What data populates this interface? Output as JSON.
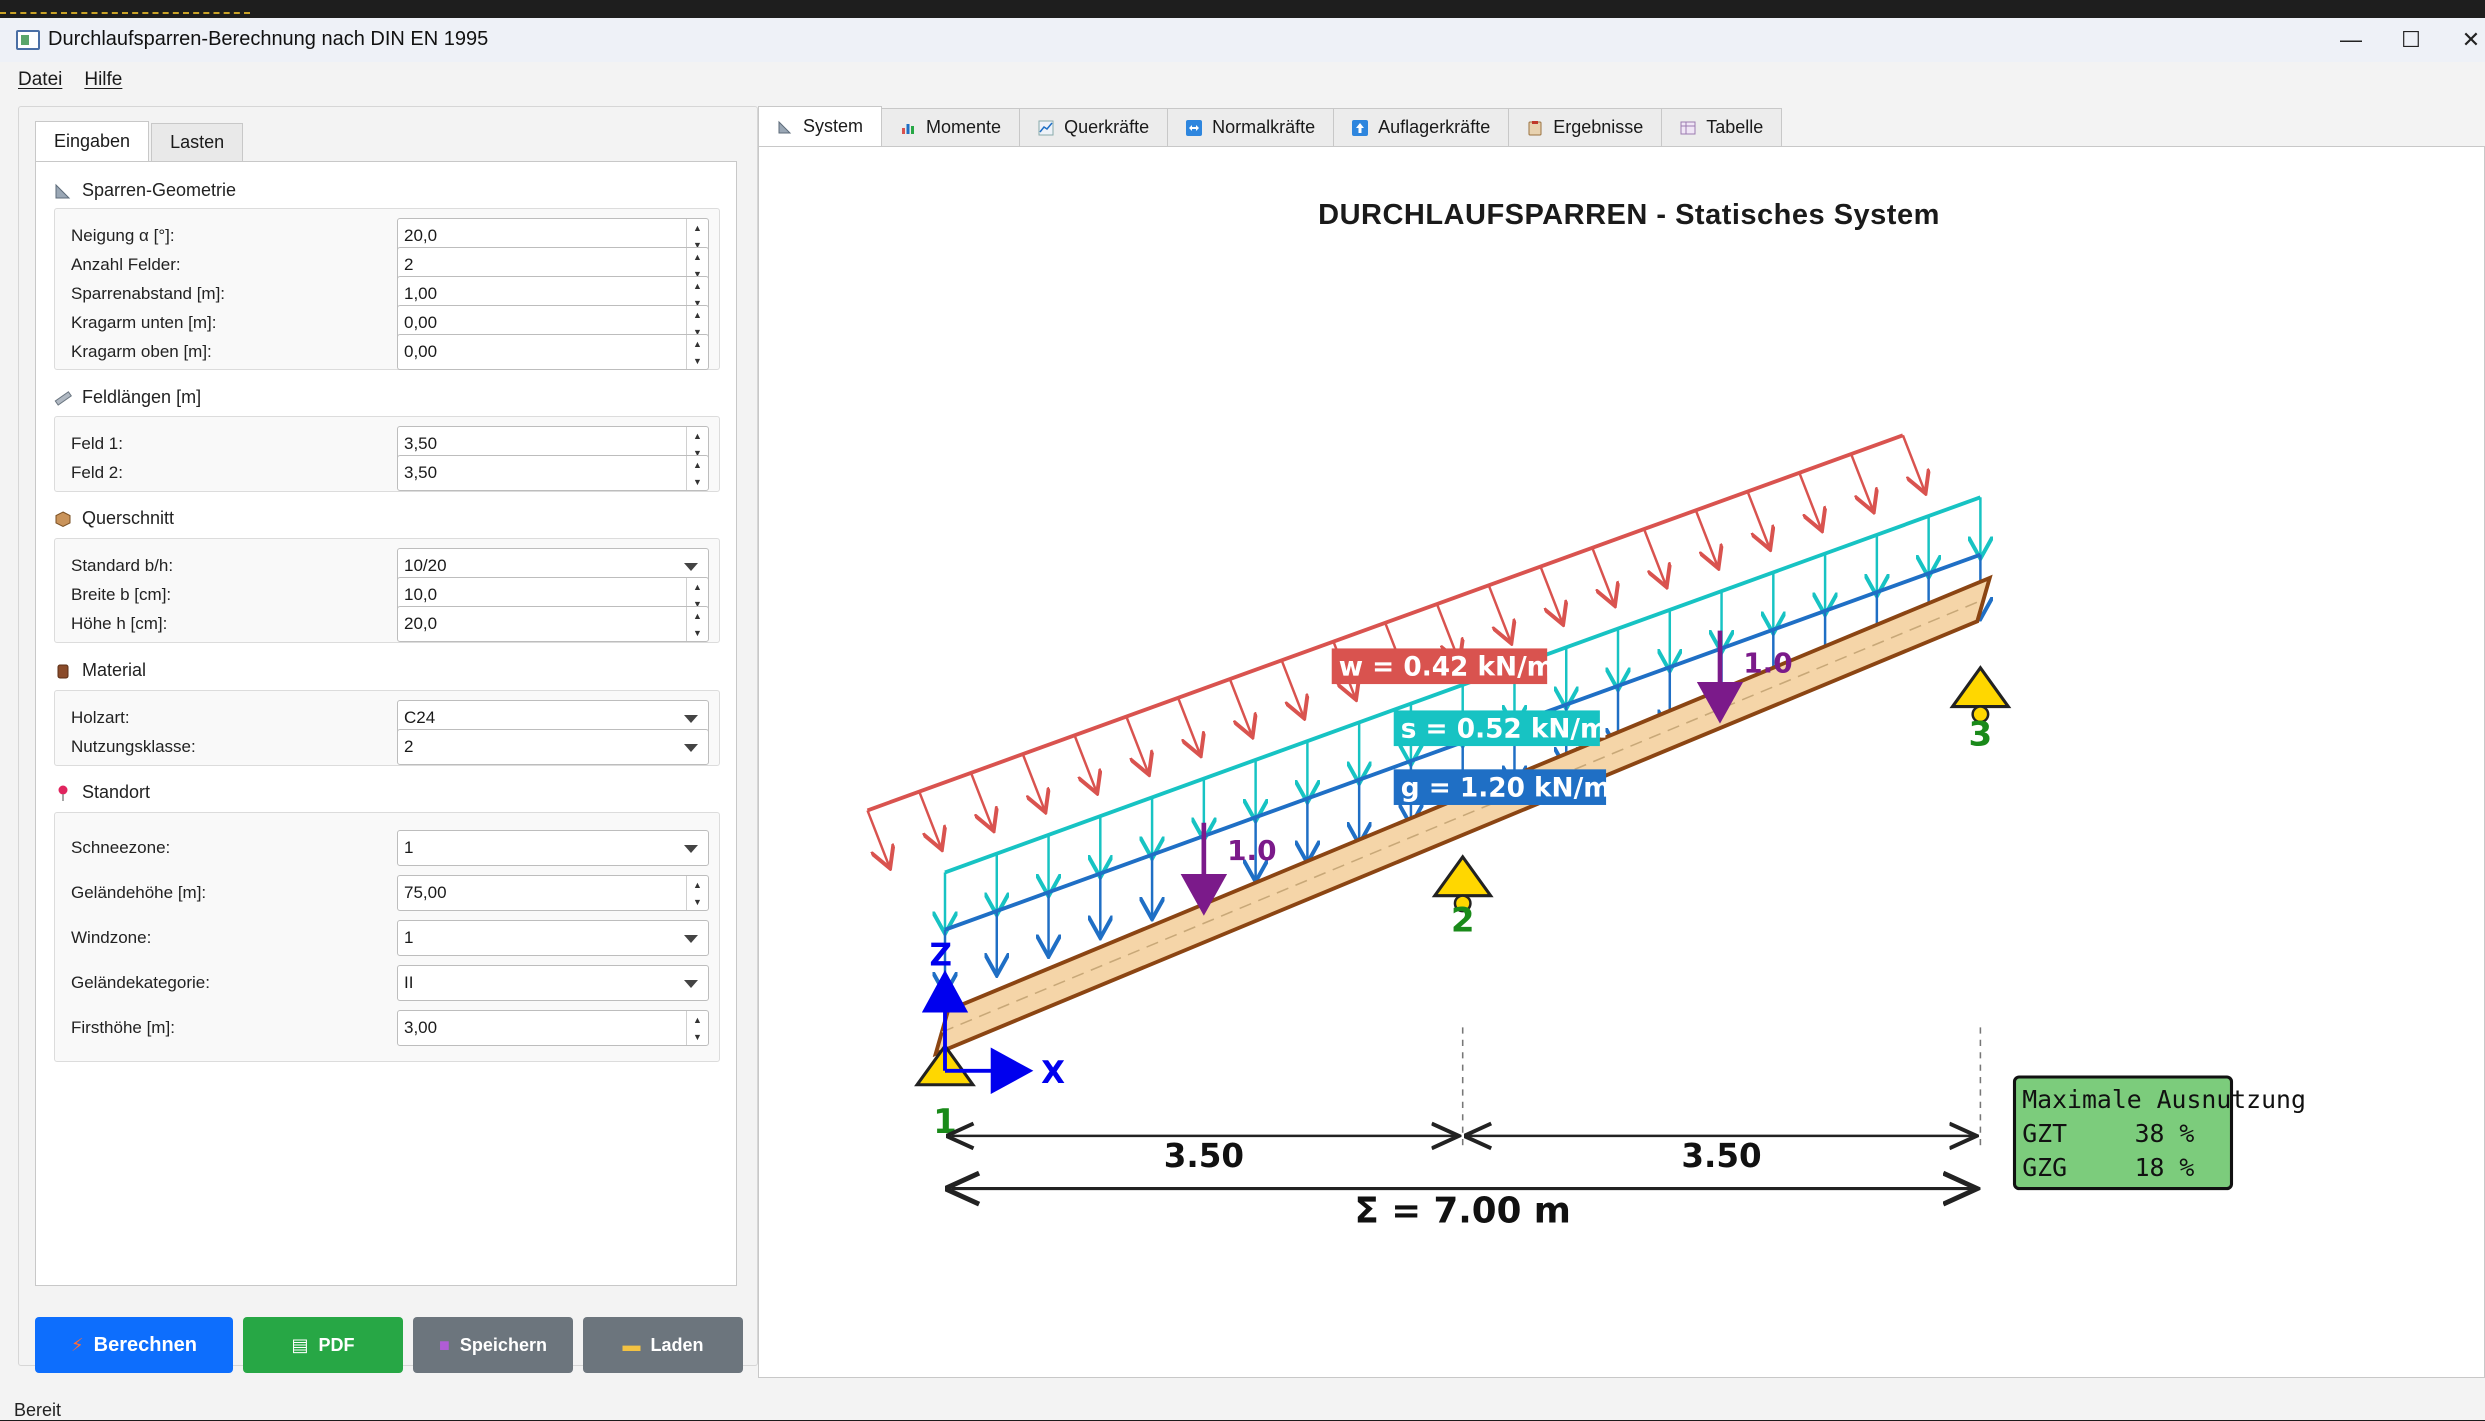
{
  "window": {
    "title": "Durchlaufsparren-Berechnung nach DIN EN 1995"
  },
  "menu": {
    "file": "Datei",
    "help": "Hilfe"
  },
  "left_tabs": [
    "Eingaben",
    "Lasten"
  ],
  "groups": {
    "geometry": {
      "title": "Sparren-Geometrie",
      "fields": [
        {
          "label": "Neigung α [°]:",
          "value": "20,0"
        },
        {
          "label": "Anzahl Felder:",
          "value": "2"
        },
        {
          "label": "Sparrenabstand [m]:",
          "value": "1,00"
        },
        {
          "label": "Kragarm unten [m]:",
          "value": "0,00"
        },
        {
          "label": "Kragarm oben [m]:",
          "value": "0,00"
        }
      ]
    },
    "spans": {
      "title": "Feldlängen [m]",
      "fields": [
        {
          "label": "Feld 1:",
          "value": "3,50"
        },
        {
          "label": "Feld 2:",
          "value": "3,50"
        }
      ]
    },
    "section": {
      "title": "Querschnitt",
      "fields": [
        {
          "label": "Standard b/h:",
          "value": "10/20"
        },
        {
          "label": "Breite b [cm]:",
          "value": "10,0"
        },
        {
          "label": "Höhe h [cm]:",
          "value": "20,0"
        }
      ]
    },
    "material": {
      "title": "Material",
      "fields": [
        {
          "label": "Holzart:",
          "value": "C24"
        },
        {
          "label": "Nutzungsklasse:",
          "value": "2"
        }
      ]
    },
    "location": {
      "title": "Standort",
      "fields": [
        {
          "label": "Schneezone:",
          "value": "1"
        },
        {
          "label": "Geländehöhe [m]:",
          "value": "75,00"
        },
        {
          "label": "Windzone:",
          "value": "1"
        },
        {
          "label": "Geländekategorie:",
          "value": "II"
        },
        {
          "label": "Firsthöhe [m]:",
          "value": "3,00"
        }
      ]
    }
  },
  "buttons": {
    "calculate": "Berechnen",
    "pdf": "PDF",
    "save": "Speichern",
    "load": "Laden"
  },
  "colors": {
    "calculate": "#0d6efd",
    "pdf": "#27a745",
    "neutral": "#6c757d",
    "wind": "#d9534f",
    "snow": "#17c3c3",
    "dead": "#1f6fc5",
    "point": "#7b1a8a",
    "beam": "#f5d5a8",
    "beam_edge": "#8b4513",
    "support": "#ffd700",
    "node": "#1a8a1a",
    "result_box": "#7ccc7c"
  },
  "status": "Bereit",
  "right_tabs": [
    "System",
    "Momente",
    "Querkräfte",
    "Normalkräfte",
    "Auflagerkräfte",
    "Ergebnisse",
    "Tabelle"
  ],
  "plot": {
    "title": "DURCHLAUFSPARREN - Statisches System",
    "loads": {
      "wind": "w = 0.42 kN/m",
      "snow": "s = 0.52 kN/m",
      "dead": "g = 1.20 kN/m",
      "point_left": "1.0",
      "point_right": "1.0"
    },
    "nodes": [
      "1",
      "2",
      "3"
    ],
    "axes": {
      "z": "Z",
      "x": "X"
    },
    "spans": [
      "3.50",
      "3.50"
    ],
    "total": "Σ = 7.00 m",
    "utilization": {
      "title": "Maximale Ausnutzung",
      "gzt_label": "GZT",
      "gzt_value": "38 %",
      "gzg_label": "GZG",
      "gzg_value": "18 %"
    }
  }
}
